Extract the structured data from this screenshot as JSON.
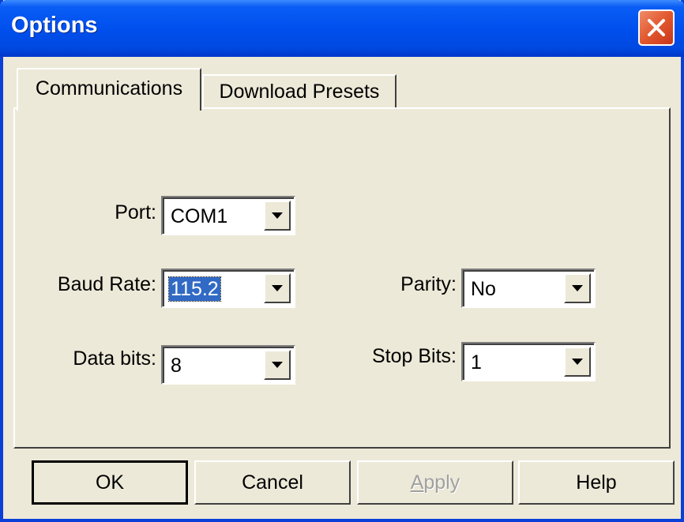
{
  "window": {
    "title": "Options",
    "close_icon": "close-icon"
  },
  "tabs": [
    {
      "label": "Communications",
      "active": true
    },
    {
      "label": "Download Presets",
      "active": false
    }
  ],
  "form": {
    "port": {
      "label": "Port:",
      "value": "COM1"
    },
    "baud_rate": {
      "label": "Baud Rate:",
      "value": "115.2",
      "selected": true
    },
    "data_bits": {
      "label": "Data bits:",
      "value": "8"
    },
    "parity": {
      "label": "Parity:",
      "value": "No"
    },
    "stop_bits": {
      "label": "Stop Bits:",
      "value": "1"
    }
  },
  "buttons": {
    "ok": "OK",
    "cancel": "Cancel",
    "apply_first": "A",
    "apply_rest": "pply",
    "help": "Help"
  },
  "colors": {
    "title_bar": "#0050ee",
    "close_button": "#e1582e",
    "dialog_background": "#ece9d8",
    "selection": "#316ac5"
  }
}
